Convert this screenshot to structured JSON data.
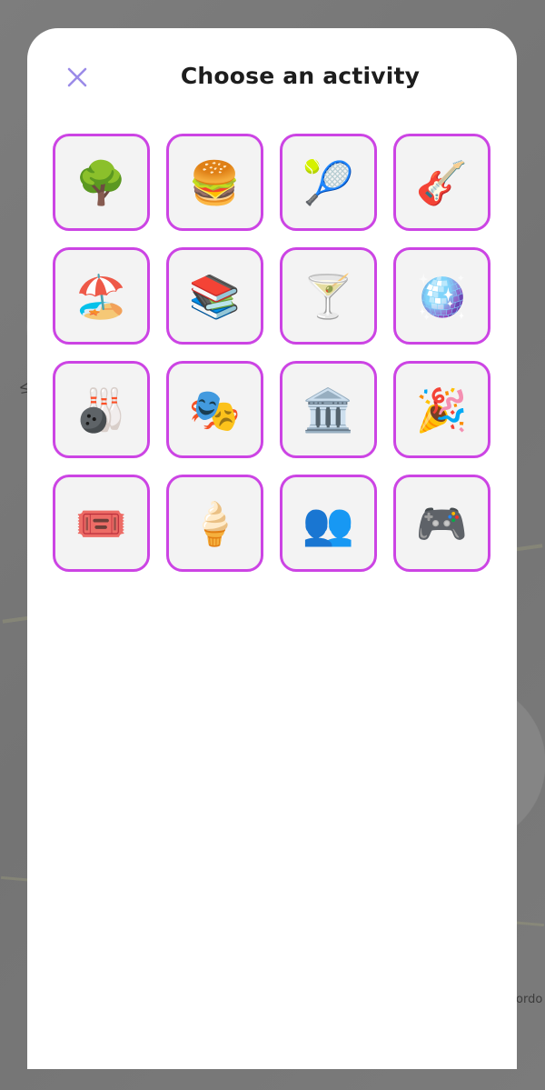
{
  "header": {
    "title": "Choose an activity",
    "close_icon": "close-icon",
    "close_color": "#9b8be8"
  },
  "background": {
    "map_labels": [
      "Vi",
      "ordo"
    ]
  },
  "activities": [
    {
      "name": "tree",
      "glyph": "🌳"
    },
    {
      "name": "burger",
      "glyph": "🍔"
    },
    {
      "name": "tennis",
      "glyph": "🎾"
    },
    {
      "name": "guitar",
      "glyph": "🎸"
    },
    {
      "name": "beach",
      "glyph": "🏖️"
    },
    {
      "name": "books",
      "glyph": "📚"
    },
    {
      "name": "cocktail",
      "glyph": "🍸"
    },
    {
      "name": "disco-ball",
      "glyph": "🪩"
    },
    {
      "name": "bowling",
      "glyph": "🎳"
    },
    {
      "name": "theater",
      "glyph": "🎭"
    },
    {
      "name": "museum",
      "glyph": "🏛️"
    },
    {
      "name": "party-popper",
      "glyph": "🎉"
    },
    {
      "name": "ticket",
      "glyph": "🎟️"
    },
    {
      "name": "ice-cream",
      "glyph": "🍦"
    },
    {
      "name": "people",
      "glyph": "👥"
    },
    {
      "name": "game-controller",
      "glyph": "🎮"
    }
  ],
  "colors": {
    "tile_border": "#cc44e4",
    "tile_background": "#f3f3f3",
    "sheet_background": "#ffffff"
  }
}
